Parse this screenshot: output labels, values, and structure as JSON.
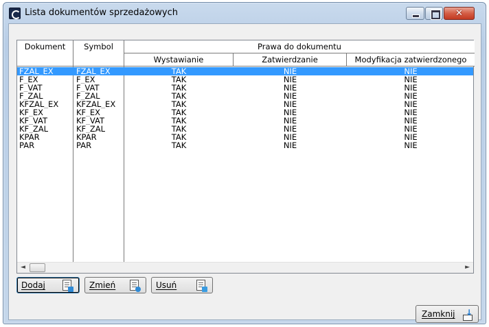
{
  "window": {
    "title": "Lista dokumentów sprzedażowych",
    "close_glyph": "✕"
  },
  "table": {
    "headers": {
      "dokument": "Dokument",
      "symbol": "Symbol",
      "group": "Prawa do dokumentu",
      "wystawianie": "Wystawianie",
      "zatwierdzanie": "Zatwierdzanie",
      "modyfikacja": "Modyfikacja zatwierdzonego"
    },
    "rows": [
      {
        "dokument": "FZAL_EX",
        "symbol": "FZAL_EX",
        "wystawianie": "TAK",
        "zatwierdzanie": "NIE",
        "modyfikacja": "NIE",
        "selected": true
      },
      {
        "dokument": "F_EX",
        "symbol": "F_EX",
        "wystawianie": "TAK",
        "zatwierdzanie": "NIE",
        "modyfikacja": "NIE"
      },
      {
        "dokument": "F_VAT",
        "symbol": "F_VAT",
        "wystawianie": "TAK",
        "zatwierdzanie": "NIE",
        "modyfikacja": "NIE"
      },
      {
        "dokument": "F_ZAL",
        "symbol": "F_ZAL",
        "wystawianie": "TAK",
        "zatwierdzanie": "NIE",
        "modyfikacja": "NIE"
      },
      {
        "dokument": "KFZAL_EX",
        "symbol": "KFZAL_EX",
        "wystawianie": "TAK",
        "zatwierdzanie": "NIE",
        "modyfikacja": "NIE"
      },
      {
        "dokument": "KF_EX",
        "symbol": "KF_EX",
        "wystawianie": "TAK",
        "zatwierdzanie": "NIE",
        "modyfikacja": "NIE"
      },
      {
        "dokument": "KF_VAT",
        "symbol": "KF_VAT",
        "wystawianie": "TAK",
        "zatwierdzanie": "NIE",
        "modyfikacja": "NIE"
      },
      {
        "dokument": "KF_ZAL",
        "symbol": "KF_ZAL",
        "wystawianie": "TAK",
        "zatwierdzanie": "NIE",
        "modyfikacja": "NIE"
      },
      {
        "dokument": "KPAR",
        "symbol": "KPAR",
        "wystawianie": "TAK",
        "zatwierdzanie": "NIE",
        "modyfikacja": "NIE"
      },
      {
        "dokument": "PAR",
        "symbol": "PAR",
        "wystawianie": "TAK",
        "zatwierdzanie": "NIE",
        "modyfikacja": "NIE"
      }
    ]
  },
  "scrollbar": {
    "left_arrow": "◄",
    "right_arrow": "►"
  },
  "actions": {
    "add_label": "Dodaj",
    "edit_label": "Zmień",
    "delete_label": "Usuń"
  },
  "footer": {
    "close_label": "Zamknij"
  },
  "icons": {
    "app": "app-icon",
    "add": "document-add-icon",
    "edit": "document-edit-icon",
    "delete": "document-delete-icon",
    "exit": "exit-icon"
  },
  "colors": {
    "selection": "#3399ff",
    "close_button": "#c23a22"
  }
}
